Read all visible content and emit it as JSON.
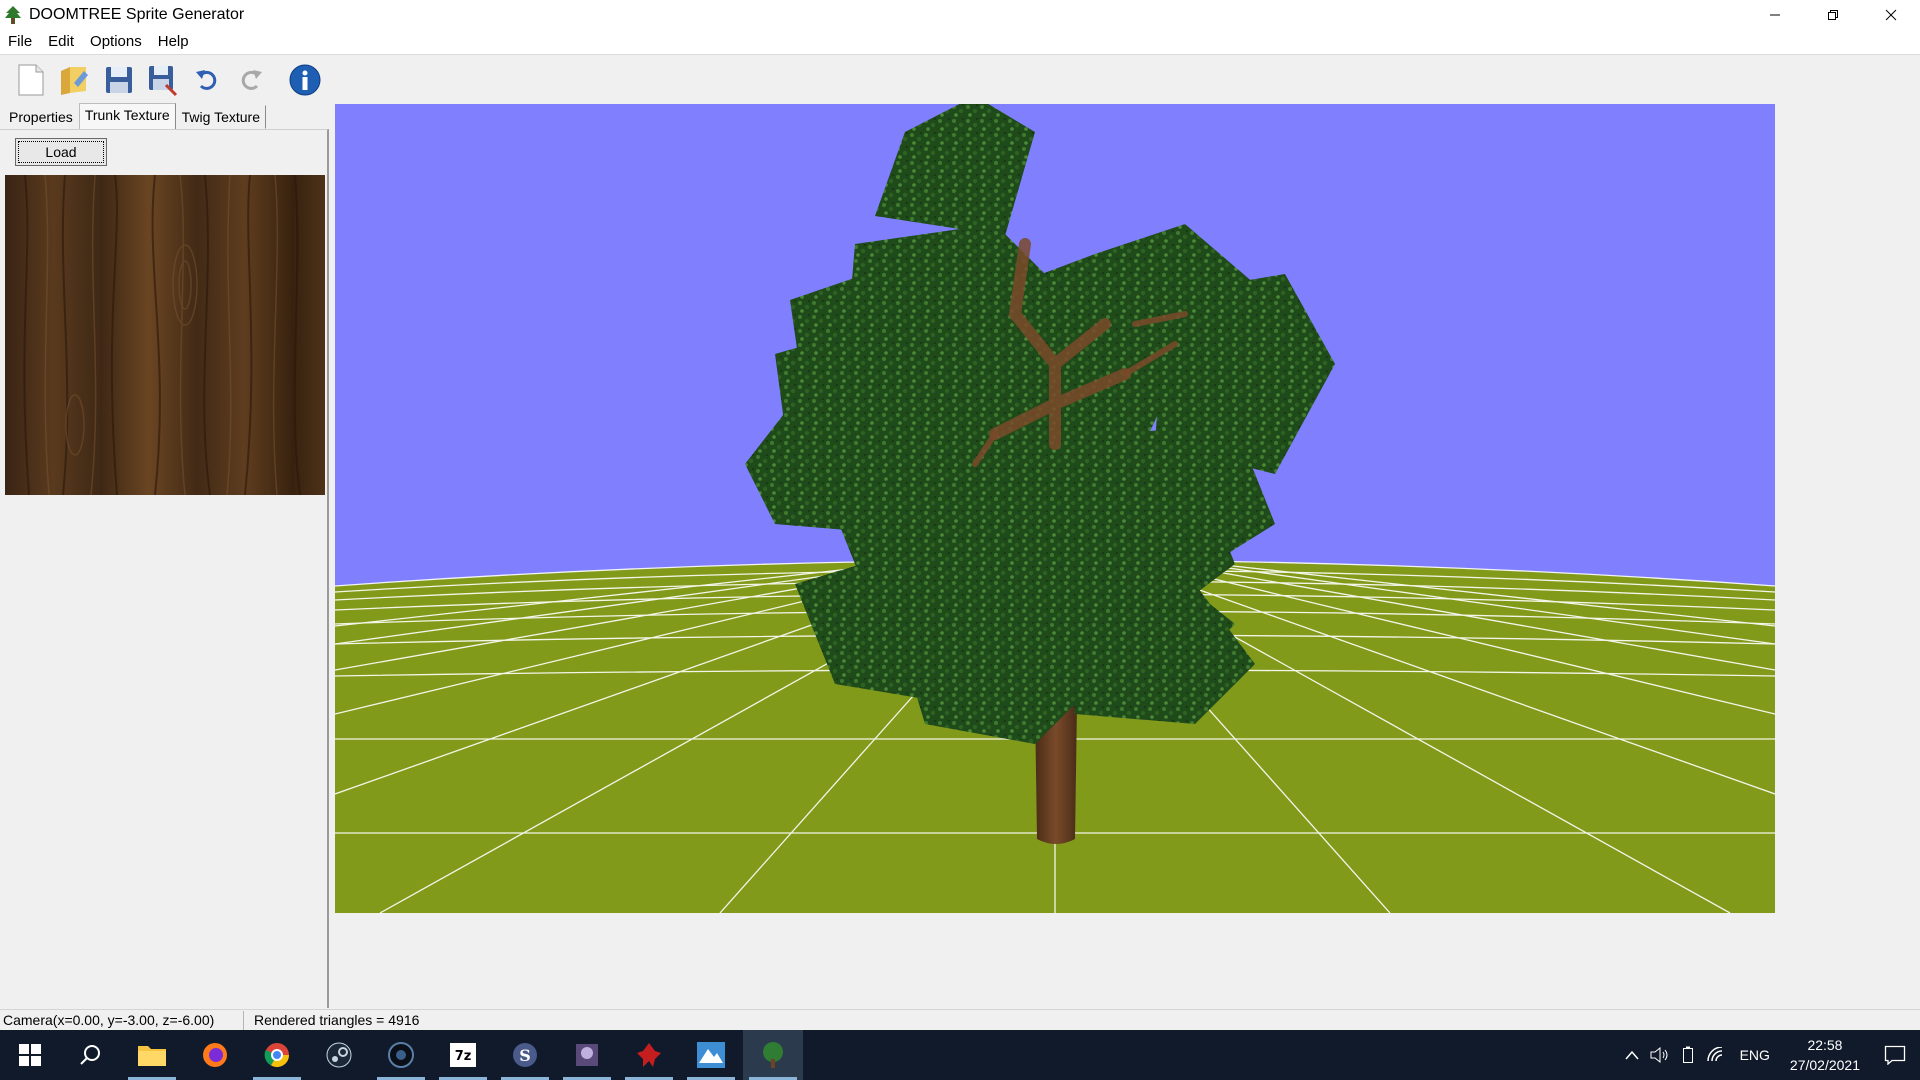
{
  "window": {
    "title": "DOOMTREE Sprite Generator"
  },
  "menu": [
    "File",
    "Edit",
    "Options",
    "Help"
  ],
  "toolbar": {
    "buttons": [
      "new-file-icon",
      "open-folder-icon",
      "save-icon",
      "save-as-icon",
      "undo-icon",
      "redo-icon",
      "info-icon"
    ]
  },
  "tabs": [
    "Properties",
    "Trunk Texture",
    "Twig Texture"
  ],
  "active_tab": "Trunk Texture",
  "panel": {
    "load_label": "Load"
  },
  "viewport": {
    "sky_color": "#8080ff",
    "ground_color": "#829a1a",
    "grid_color": "#ffffff"
  },
  "status": {
    "camera": "Camera(x=0.00, y=-3.00, z=-6.00)",
    "triangles": "Rendered triangles = 4916"
  },
  "taskbar": {
    "apps": [
      "start",
      "search",
      "file-explorer",
      "firefox",
      "chrome",
      "steam",
      "app-dark",
      "7zip",
      "slade",
      "ultimate-doom-builder",
      "doom-red",
      "terragen",
      "doomtree"
    ],
    "lang": "ENG",
    "time": "22:58",
    "date": "27/02/2021"
  },
  "colors": {
    "taskbar": "#101a2a",
    "chrome": "#f0f0f0"
  }
}
